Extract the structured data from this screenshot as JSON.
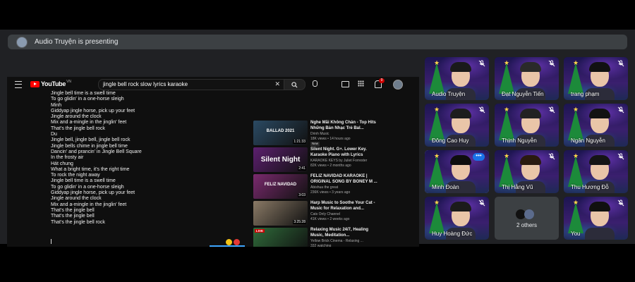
{
  "banner": {
    "text": "Audio Truyện is presenting"
  },
  "youtube": {
    "logo": "YouTube",
    "country": "VN",
    "search_query": "jingle bell rock slow lyrics karaoke",
    "notification_count": "9"
  },
  "lyrics": [
    "Jingle bell time is a swell time",
    "To go glidin' in a one-horse sleigh",
    "Minh",
    "Giddyap jingle horse, pick up your feet",
    "Jingle around the clock",
    "Mix and a-mingle in the jinglin' feet",
    "That's the jingle bell rock",
    "Du",
    "Jingle bell, jingle bell, jingle bell rock",
    "Jingle bells chime in jingle bell time",
    "Dancin' and prancin' in Jingle Bell Square",
    "In the frosty air",
    "Hát chung",
    "What a bright time, it's the right time",
    "To rock the night away",
    "Jingle bell time is a swell time",
    "To go glidin' in a one-horse sleigh",
    "Giddyap jingle horse, pick up your feet",
    "Jingle around the clock",
    "Mix and a-mingle in the jinglin' feet",
    "That's the jingle bell",
    "That's the jingle bell",
    "That's the jingle bell rock"
  ],
  "recommendations": [
    {
      "title": "Nghe Mãi Không Chán - Top Hits Những Bản Nhạc Trẻ Bal...",
      "channel": "Drinh Music",
      "meta": "18K views • 14 hours ago",
      "badge": "New",
      "duration": "1:21:33",
      "thumb_text": "BALLAD 2021",
      "color": "#2b4a63"
    },
    {
      "title": "Silent Night. G+. Lower Key. Karaoke Piano with Lyrics",
      "channel": "KARAOKE KEYS by Juliet Forrester",
      "meta": "82K views • 2 months ago",
      "badge": "",
      "duration": "2:41",
      "thumb_text": "Silent Night",
      "color": "#5c1f6e"
    },
    {
      "title": "FELIZ NAVIDAD KARAOKE | ORIGINAL SONG BY BONEY M ...",
      "channel": "Abishua the great",
      "meta": "236K views • 3 years ago",
      "badge": "",
      "duration": "3:03",
      "thumb_text": "FELIZ NAVIDAD",
      "color": "#7a2a6e"
    },
    {
      "title": "Harp Music to Soothe Your Cat - Music for Relaxation and...",
      "channel": "Cats Only Channel",
      "meta": "41K views • 2 weeks ago",
      "badge": "",
      "duration": "3:25:28",
      "thumb_text": "",
      "color": "#8a7a66"
    },
    {
      "title": "Relaxing Music 24/7, Healing Music, Meditation...",
      "channel": "Yellow Brick Cinema - Relaxing ...",
      "meta": "332 watching",
      "badge": "",
      "duration": "LIVE",
      "thumb_text": "",
      "color": "#2f6b3a"
    }
  ],
  "participants": [
    {
      "name": "Audio Truyện",
      "active": false
    },
    {
      "name": "Đạt Nguyễn Tiến",
      "active": false
    },
    {
      "name": "trang phạm",
      "active": false
    },
    {
      "name": "Đông Cao Huy",
      "active": false
    },
    {
      "name": "Thịnh Nguyễn",
      "active": false
    },
    {
      "name": "Ngân Nguyễn",
      "active": false
    },
    {
      "name": "Minh Đoàn",
      "active": true
    },
    {
      "name": "Thị Hằng Vũ",
      "active": false
    },
    {
      "name": "Thu Hương Đỗ",
      "active": false
    },
    {
      "name": "Huy Hoàng Đức",
      "active": false
    },
    {
      "name": "You",
      "active": false
    }
  ],
  "others_label": "2 others",
  "more_options": "•••",
  "colors": {
    "background": "#202124",
    "accent": "#8ab4f8",
    "youtube_red": "#ff0000"
  }
}
